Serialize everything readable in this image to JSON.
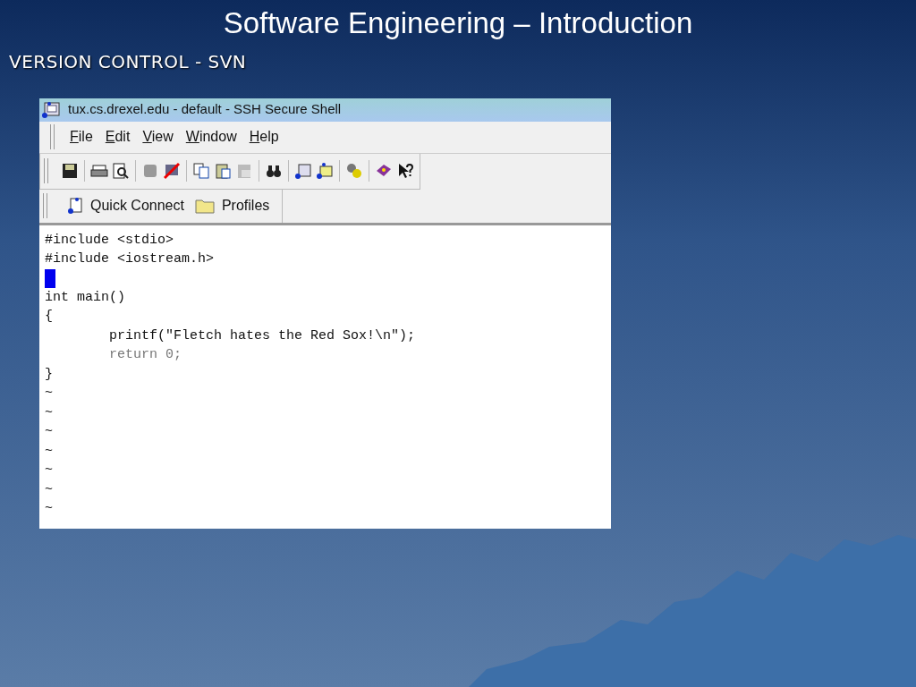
{
  "slide": {
    "title": "Software Engineering – Introduction",
    "subtitle": "VERSION CONTROL - SVN"
  },
  "window": {
    "title": "tux.cs.drexel.edu - default - SSH Secure Shell",
    "menu": [
      "File",
      "Edit",
      "View",
      "Window",
      "Help"
    ],
    "quickbar": [
      {
        "kind": "connect",
        "label": "Quick Connect"
      },
      {
        "kind": "folder",
        "label": "Profiles"
      }
    ],
    "lines": [
      {
        "kind": "code",
        "text": "#include <stdio>",
        "dim": false
      },
      {
        "kind": "code",
        "text": "#include <iostream.h>",
        "dim": false
      },
      {
        "kind": "cursor"
      },
      {
        "kind": "code",
        "text": "int main()",
        "dim": false
      },
      {
        "kind": "code",
        "text": "{",
        "dim": false
      },
      {
        "kind": "code",
        "text": "        printf(\"Fletch hates the Red Sox!\\n\");",
        "dim": false
      },
      {
        "kind": "code",
        "text": "        return 0;",
        "dim": true
      },
      {
        "kind": "code",
        "text": "}",
        "dim": false
      },
      {
        "kind": "tilde",
        "text": "~"
      },
      {
        "kind": "tilde",
        "text": "~"
      },
      {
        "kind": "tilde",
        "text": "~"
      },
      {
        "kind": "tilde",
        "text": "~"
      },
      {
        "kind": "tilde",
        "text": "~"
      },
      {
        "kind": "tilde",
        "text": "~"
      },
      {
        "kind": "tilde",
        "text": "~"
      }
    ]
  }
}
